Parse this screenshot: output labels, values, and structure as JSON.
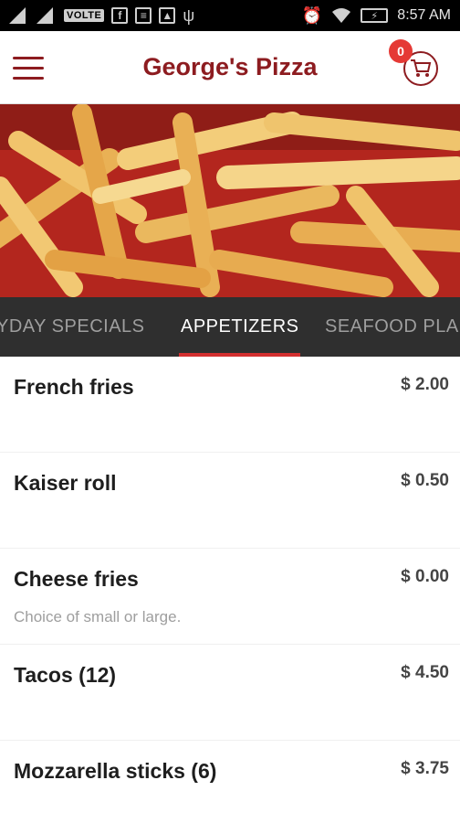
{
  "status_bar": {
    "network_label": "VOLTE",
    "time": "8:57 AM"
  },
  "app_bar": {
    "title": "George's Pizza",
    "cart_count": "0"
  },
  "hero": {
    "image_subject": "french-fries-photo"
  },
  "tabs": [
    {
      "label": "YDAY SPECIALS",
      "active": false
    },
    {
      "label": "APPETIZERS",
      "active": true
    },
    {
      "label": "SEAFOOD PLA",
      "active": false
    }
  ],
  "menu_items": [
    {
      "name": "French fries",
      "price": "$ 2.00",
      "description": ""
    },
    {
      "name": "Kaiser roll",
      "price": "$ 0.50",
      "description": ""
    },
    {
      "name": "Cheese fries",
      "price": "$ 0.00",
      "description": "Choice of small or large."
    },
    {
      "name": "Tacos (12)",
      "price": "$ 4.50",
      "description": ""
    },
    {
      "name": "Mozzarella sticks (6)",
      "price": "$ 3.75",
      "description": ""
    }
  ],
  "colors": {
    "brand": "#8d1c20",
    "tab_bar": "#2f2f2f",
    "tab_indicator": "#d32f2f",
    "badge": "#e53935"
  }
}
